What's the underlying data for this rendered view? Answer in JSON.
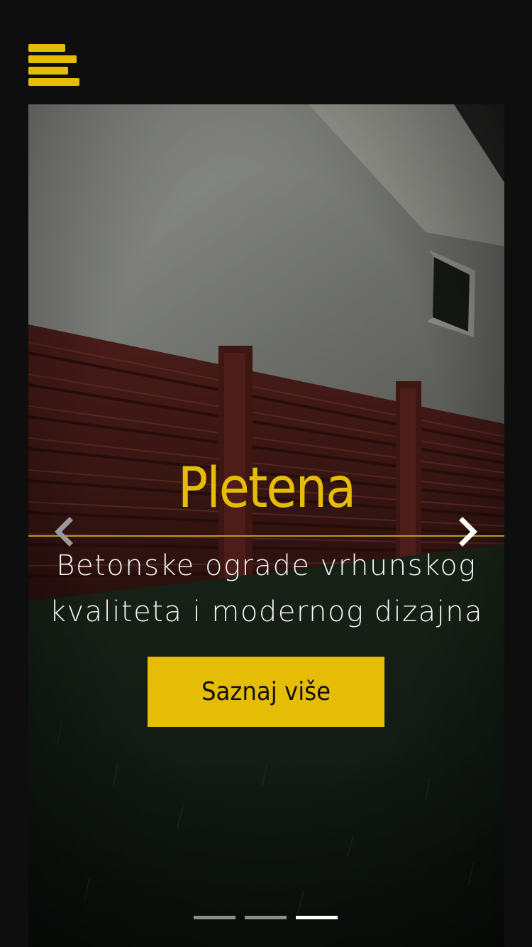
{
  "header": {
    "menu_icon": "hamburger-menu-icon",
    "accent_color": "#e5bd06",
    "background_color": "#0e0e0e"
  },
  "slider": {
    "title": "Pletena",
    "subtitle": "Betonske ograde vrhunskog kvaliteta i modernog dizajna",
    "button_label": "Saznaj više",
    "prev_icon": "chevron-left-icon",
    "next_icon": "chevron-right-icon",
    "slide_count": 3,
    "active_slide": 3
  }
}
